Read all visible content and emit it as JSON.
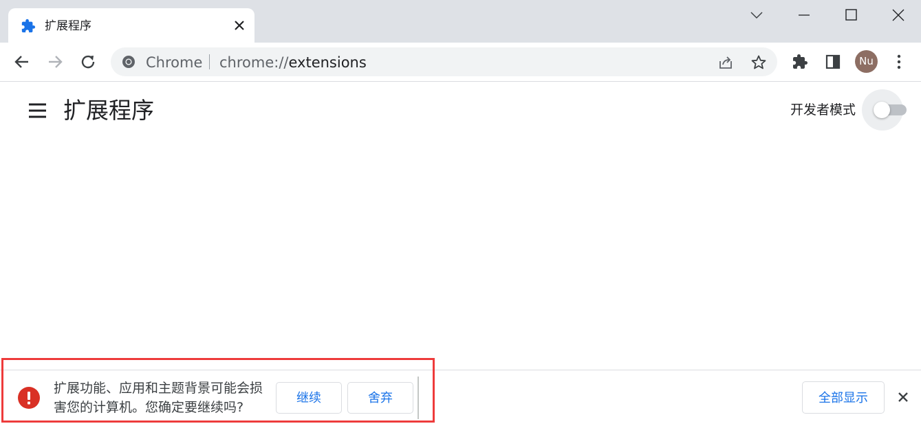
{
  "tab": {
    "title": "扩展程序",
    "icon": "extension-puzzle-icon",
    "close_icon": "close-icon"
  },
  "window_controls": [
    "tab-search-icon",
    "minimize-icon",
    "maximize-icon",
    "close-window-icon"
  ],
  "toolbar": {
    "omnibox": {
      "site_label": "Chrome",
      "url_scheme": "chrome://",
      "url_host": "extensions"
    },
    "avatar_initials": "Nu"
  },
  "page": {
    "title": "扩展程序",
    "developer_mode": {
      "label": "开发者模式",
      "enabled": false
    }
  },
  "download_bar": {
    "warning_text": "扩展功能、应用和主题背景可能会损害您的计算机。您确定要继续吗?",
    "continue_label": "继续",
    "discard_label": "舍弃",
    "show_all_label": "全部显示"
  },
  "colors": {
    "accent": "#1a73e8",
    "warning": "#d93025",
    "highlight": "#ee3b3b",
    "tabstrip": "#dee1e6"
  }
}
